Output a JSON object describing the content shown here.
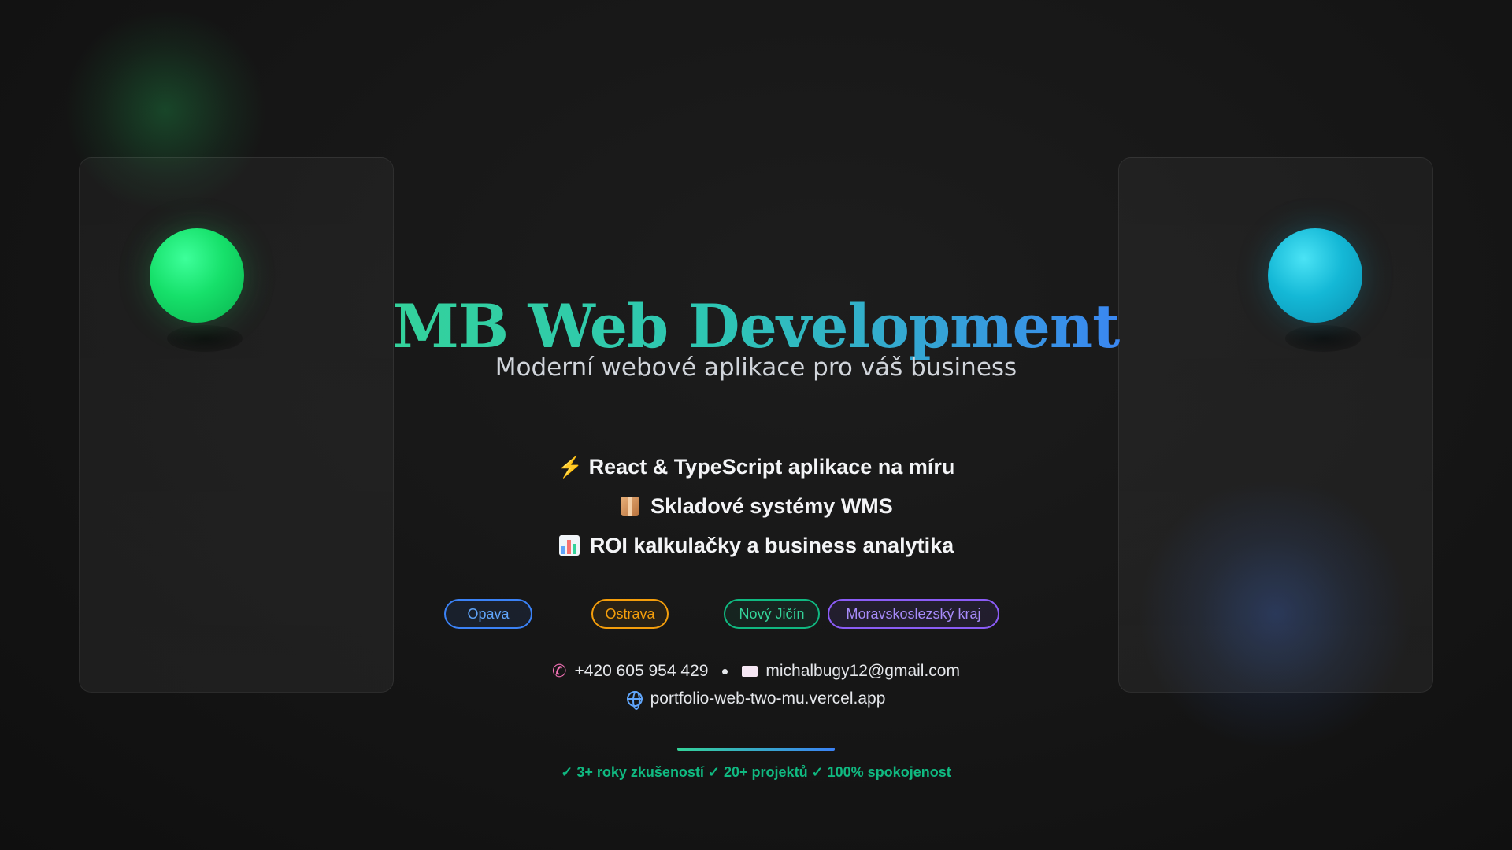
{
  "brand": {
    "title": "MB Web Development",
    "subtitle": "Moderní webové aplikace pro váš business"
  },
  "features": [
    {
      "icon": "lightning-icon",
      "label": "React & TypeScript aplikace na míru"
    },
    {
      "icon": "package-icon",
      "label": "Skladové systémy WMS"
    },
    {
      "icon": "bar-chart-icon",
      "label": "ROI kalkulačky a business analytika"
    }
  ],
  "locations": [
    {
      "label": "Opava",
      "color": "#3b82f6"
    },
    {
      "label": "Ostrava",
      "color": "#f59e0b"
    },
    {
      "label": "Nový Jičín",
      "color": "#10b981"
    },
    {
      "label": "Moravskoslezský kraj",
      "color": "#8b5cf6"
    }
  ],
  "contact": {
    "phone": "+420 605 954 429",
    "email": "michalbugy12@gmail.com",
    "website": "portfolio-web-two-mu.vercel.app"
  },
  "stats": "✓ 3+ roky zkušeností ✓ 20+ projektů ✓ 100% spokojenost",
  "colors": {
    "accent_green": "#34d399",
    "accent_blue": "#3b82f6",
    "sphere_green": "#16e06a",
    "sphere_cyan": "#14b8d6",
    "background": "#171717"
  }
}
